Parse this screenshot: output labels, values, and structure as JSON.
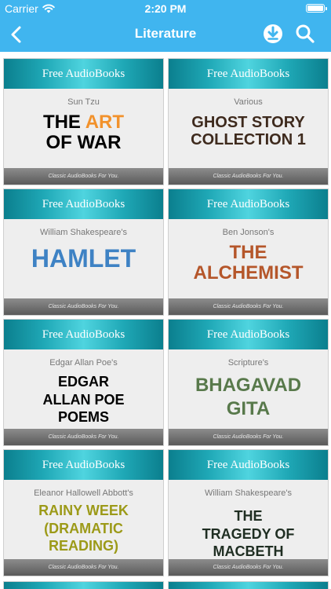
{
  "status_bar": {
    "carrier": "Carrier",
    "time": "2:20 PM"
  },
  "nav": {
    "title": "Literature",
    "icons": [
      "back-chevron-icon",
      "download-icon",
      "search-icon"
    ]
  },
  "colors": {
    "nav_bg": "#40b5ef",
    "banner_teal": "#1fa8b6"
  },
  "books": [
    {
      "banner": "Free AudioBooks",
      "author": "Sun Tzu",
      "title_pre": "THE ",
      "title_accent": "ART",
      "title_post": " OF WAR",
      "footer": "Classic AudioBooks For You."
    },
    {
      "banner": "Free AudioBooks",
      "author": "Various",
      "title": "GHOST STORY COLLECTION 1",
      "footer": "Classic AudioBooks For You."
    },
    {
      "banner": "Free AudioBooks",
      "author": "William Shakespeare's",
      "title": "HAMLET",
      "footer": "Classic AudioBooks For You."
    },
    {
      "banner": "Free AudioBooks",
      "author": "Ben Jonson's",
      "title": "THE ALCHEMIST",
      "footer": "Classic AudioBooks For You."
    },
    {
      "banner": "Free AudioBooks",
      "author": "Edgar Allan Poe's",
      "title": "EDGAR ALLAN POE POEMS",
      "footer": "Classic AudioBooks For You."
    },
    {
      "banner": "Free AudioBooks",
      "author": "Scripture's",
      "title": "BHAGAVAD GITA",
      "footer": "Classic AudioBooks For You."
    },
    {
      "banner": "Free AudioBooks",
      "author": "Eleanor Hallowell Abbott's",
      "title": "RAINY WEEK (DRAMATIC READING)",
      "footer": "Classic AudioBooks For You."
    },
    {
      "banner": "Free AudioBooks",
      "author": "William Shakespeare's",
      "title": "THE TRAGEDY OF MACBETH",
      "footer": "Classic AudioBooks For You."
    }
  ]
}
